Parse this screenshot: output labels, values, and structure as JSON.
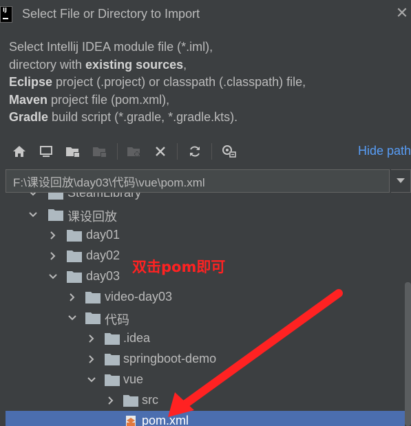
{
  "dialog": {
    "title": "Select File or Directory to Import",
    "app_logo_text": "IJ"
  },
  "description": {
    "line1": "Select Intellij IDEA module file (*.iml),",
    "line2_pre": "directory with ",
    "line2_bold": "existing sources",
    "line2_post": ",",
    "line3_bold": "Eclipse",
    "line3_post": " project (.project) or classpath (.classpath) file,",
    "line4_bold": "Maven",
    "line4_post": " project file (pom.xml),",
    "line5_bold": "Gradle",
    "line5_post": " build script (*.gradle, *.gradle.kts)."
  },
  "toolbar": {
    "hide_path_label": "Hide path",
    "icons": [
      "home-icon",
      "desktop-icon",
      "project-folder-icon",
      "module-folder-icon",
      "new-folder-icon",
      "delete-icon",
      "refresh-icon",
      "show-hidden-icon"
    ]
  },
  "path": {
    "value": "F:\\课设回放\\day03\\代码\\vue\\pom.xml"
  },
  "tree": {
    "items": [
      {
        "label": "SteamLibrary",
        "expanded": true
      },
      {
        "label": "课设回放",
        "expanded": true
      },
      {
        "label": "day01",
        "expanded": false
      },
      {
        "label": "day02",
        "expanded": false
      },
      {
        "label": "day03",
        "expanded": true
      },
      {
        "label": "video-day03",
        "expanded": false
      },
      {
        "label": "代码",
        "expanded": true
      },
      {
        "label": ".idea",
        "expanded": false
      },
      {
        "label": "springboot-demo",
        "expanded": false
      },
      {
        "label": "vue",
        "expanded": true
      },
      {
        "label": "src",
        "expanded": false
      },
      {
        "label": "pom.xml",
        "selected": true
      }
    ]
  },
  "annotation": {
    "text": "双击pom即可",
    "color": "#ff2222"
  },
  "colors": {
    "background": "#3c3f41",
    "selection": "#4b6eaf",
    "link": "#589df6",
    "folder": "#aeb9c0"
  }
}
